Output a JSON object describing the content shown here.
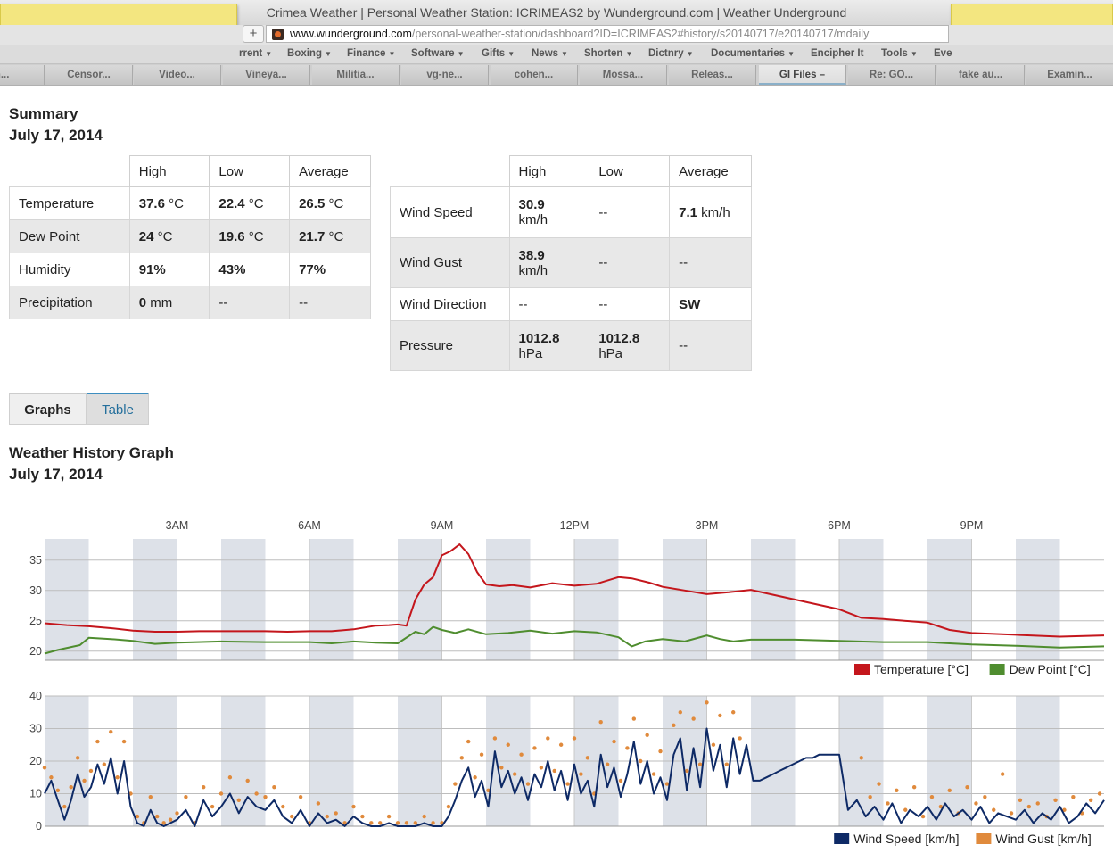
{
  "browser": {
    "window_title": "Crimea Weather | Personal Weather Station: ICRIMEAS2 by Wunderground.com | Weather Underground",
    "url_host": "www.wunderground.com",
    "url_path": "/personal-weather-station/dashboard?ID=ICRIMEAS2#history/s20140717/e20140717/mdaily",
    "add_symbol": "+",
    "bookmarks": [
      "rrent",
      "Boxing",
      "Finance",
      "Software",
      "Gifts",
      "News",
      "Shorten",
      "Dictnry",
      "Documentaries",
      "Encipher It",
      "Tools",
      "Eve"
    ],
    "bookmark_caret": "▼",
    "tabs": [
      "m...",
      "Censor...",
      "Video...",
      "Vineya...",
      "Militia...",
      "vg-ne...",
      "cohen...",
      "Mossa...",
      "Releas...",
      "GI Files –",
      "Re: GO...",
      "fake au...",
      "Examin..."
    ],
    "active_tab": "GI Files –"
  },
  "summary": {
    "title": "Summary",
    "date": "July 17, 2014",
    "left_table": {
      "headers": [
        "High",
        "Low",
        "Average"
      ],
      "rows": [
        {
          "label": "Temperature",
          "high": "37.6",
          "high_unit": "°C",
          "low": "22.4",
          "low_unit": "°C",
          "avg": "26.5",
          "avg_unit": "°C"
        },
        {
          "label": "Dew Point",
          "high": "24",
          "high_unit": "°C",
          "low": "19.6",
          "low_unit": "°C",
          "avg": "21.7",
          "avg_unit": "°C"
        },
        {
          "label": "Humidity",
          "high": "91%",
          "high_unit": "",
          "low": "43%",
          "low_unit": "",
          "avg": "77%",
          "avg_unit": ""
        },
        {
          "label": "Precipitation",
          "high": "0",
          "high_unit": "mm",
          "low": "--",
          "low_unit": "",
          "avg": "--",
          "avg_unit": ""
        }
      ]
    },
    "right_table": {
      "headers": [
        "High",
        "Low",
        "Average"
      ],
      "rows": [
        {
          "label": "Wind Speed",
          "high": "30.9",
          "high_unit": "km/h",
          "low": "--",
          "low_unit": "",
          "avg": "7.1",
          "avg_unit": "km/h"
        },
        {
          "label": "Wind Gust",
          "high": "38.9",
          "high_unit": "km/h",
          "low": "--",
          "low_unit": "",
          "avg": "--",
          "avg_unit": ""
        },
        {
          "label": "Wind Direction",
          "high": "--",
          "high_unit": "",
          "low": "--",
          "low_unit": "",
          "avg": "SW",
          "avg_unit": ""
        },
        {
          "label": "Pressure",
          "high": "1012.8",
          "high_unit": "hPa",
          "low": "1012.8",
          "low_unit": "hPa",
          "avg": "--",
          "avg_unit": ""
        }
      ]
    }
  },
  "view_tabs": {
    "graphs": "Graphs",
    "table": "Table",
    "selected": "Graphs"
  },
  "history": {
    "title": "Weather History Graph",
    "date": "July 17, 2014"
  },
  "colors": {
    "temperature": "#c4161c",
    "dewpoint": "#4f8d2f",
    "wind_speed": "#0e2a66",
    "wind_gust": "#e08a3c",
    "band": "#dde1e8"
  },
  "chart_data": [
    {
      "type": "line",
      "x_axis_unit": "hour of day",
      "x_ticks": [
        {
          "hour": 3,
          "label": "3AM"
        },
        {
          "hour": 6,
          "label": "6AM"
        },
        {
          "hour": 9,
          "label": "9AM"
        },
        {
          "hour": 12,
          "label": "12PM"
        },
        {
          "hour": 15,
          "label": "3PM"
        },
        {
          "hour": 18,
          "label": "6PM"
        },
        {
          "hour": 21,
          "label": "9PM"
        }
      ],
      "xlim": [
        0,
        24
      ],
      "ylim": [
        18.5,
        38.5
      ],
      "y_ticks": [
        20,
        25,
        30,
        35
      ],
      "grid": true,
      "legend_position": "bottom-right",
      "series": [
        {
          "name": "Temperature [°C]",
          "x": [
            0,
            0.5,
            1,
            1.5,
            2,
            2.5,
            3,
            3.5,
            4,
            4.5,
            5,
            5.5,
            6,
            6.5,
            7,
            7.5,
            7.8,
            8,
            8.2,
            8.4,
            8.6,
            8.8,
            9,
            9.2,
            9.4,
            9.6,
            9.8,
            10,
            10.3,
            10.6,
            11,
            11.5,
            12,
            12.5,
            13,
            13.3,
            13.7,
            14,
            14.5,
            15,
            15.5,
            16,
            17,
            18,
            18.5,
            19,
            20,
            20.5,
            21,
            22,
            23,
            24
          ],
          "y": [
            24.6,
            24.3,
            24.1,
            23.8,
            23.4,
            23.2,
            23.2,
            23.3,
            23.3,
            23.3,
            23.3,
            23.2,
            23.3,
            23.3,
            23.6,
            24.2,
            24.3,
            24.4,
            24.2,
            28.5,
            31.0,
            32.2,
            35.8,
            36.5,
            37.6,
            36.0,
            33.0,
            31.0,
            30.7,
            30.9,
            30.5,
            31.2,
            30.8,
            31.1,
            32.2,
            32.0,
            31.3,
            30.6,
            30.0,
            29.4,
            29.7,
            30.1,
            28.5,
            26.9,
            25.5,
            25.3,
            24.7,
            23.5,
            23.0,
            22.7,
            22.4,
            22.6
          ]
        },
        {
          "name": "Dew Point [°C]",
          "x": [
            0,
            0.3,
            0.8,
            1,
            1.5,
            2,
            2.5,
            3,
            4,
            5,
            6,
            6.5,
            7,
            7.5,
            8,
            8.4,
            8.6,
            8.8,
            9,
            9.3,
            9.6,
            10,
            10.5,
            11,
            11.5,
            12,
            12.5,
            13,
            13.3,
            13.6,
            14,
            14.5,
            15,
            15.3,
            15.6,
            16,
            17,
            18,
            19,
            20,
            20.5,
            21,
            22,
            23,
            24
          ],
          "y": [
            19.6,
            20.2,
            21.0,
            22.2,
            22.0,
            21.7,
            21.2,
            21.4,
            21.6,
            21.5,
            21.5,
            21.3,
            21.6,
            21.4,
            21.3,
            23.2,
            22.8,
            24.0,
            23.5,
            23.0,
            23.6,
            22.8,
            23.0,
            23.4,
            22.9,
            23.3,
            23.1,
            22.3,
            20.8,
            21.6,
            22.0,
            21.6,
            22.6,
            22.0,
            21.6,
            21.9,
            21.9,
            21.7,
            21.5,
            21.5,
            21.3,
            21.1,
            20.9,
            20.6,
            20.8
          ]
        }
      ]
    },
    {
      "type": "line",
      "x_axis_unit": "hour of day",
      "xlim": [
        0,
        24
      ],
      "ylim": [
        0,
        40
      ],
      "y_ticks": [
        0,
        10,
        20,
        30,
        40
      ],
      "grid": true,
      "legend_position": "bottom-right",
      "series": [
        {
          "name": "Wind Speed [km/h]",
          "x": [
            0,
            0.15,
            0.3,
            0.45,
            0.6,
            0.75,
            0.9,
            1.05,
            1.2,
            1.35,
            1.5,
            1.65,
            1.8,
            1.95,
            2.1,
            2.25,
            2.4,
            2.55,
            2.7,
            2.85,
            3,
            3.2,
            3.4,
            3.6,
            3.8,
            4,
            4.2,
            4.4,
            4.6,
            4.8,
            5,
            5.2,
            5.4,
            5.6,
            5.8,
            6,
            6.2,
            6.4,
            6.6,
            6.8,
            7,
            7.2,
            7.4,
            7.6,
            7.8,
            8,
            8.2,
            8.4,
            8.6,
            8.8,
            9,
            9.15,
            9.3,
            9.45,
            9.6,
            9.75,
            9.9,
            10.05,
            10.2,
            10.35,
            10.5,
            10.65,
            10.8,
            10.95,
            11.1,
            11.25,
            11.4,
            11.55,
            11.7,
            11.85,
            12,
            12.15,
            12.3,
            12.45,
            12.6,
            12.75,
            12.9,
            13.05,
            13.2,
            13.35,
            13.5,
            13.65,
            13.8,
            13.95,
            14.1,
            14.25,
            14.4,
            14.55,
            14.7,
            14.85,
            15,
            15.15,
            15.3,
            15.45,
            15.6,
            15.75,
            15.9,
            16.05,
            16.2,
            16.35,
            16.5,
            16.65,
            16.8,
            16.95,
            17.1,
            17.25,
            17.4,
            17.55,
            17.7,
            17.85,
            18,
            18.2,
            18.4,
            18.6,
            18.8,
            19,
            19.2,
            19.4,
            19.6,
            19.8,
            20,
            20.2,
            20.4,
            20.6,
            20.8,
            21,
            21.2,
            21.4,
            21.6,
            21.8,
            22,
            22.2,
            22.4,
            22.6,
            22.8,
            23,
            23.2,
            23.4,
            23.6,
            23.8,
            24
          ],
          "y": [
            10,
            14,
            8,
            2,
            8,
            16,
            9,
            12,
            19,
            13,
            21,
            10,
            20,
            6,
            1,
            0,
            5,
            1,
            0,
            1,
            2,
            5,
            0,
            8,
            3,
            6,
            10,
            4,
            9,
            6,
            5,
            8,
            3,
            1,
            5,
            0,
            4,
            1,
            2,
            0,
            3,
            1,
            0,
            0,
            1,
            0,
            0,
            0,
            1,
            0,
            0,
            3,
            8,
            14,
            18,
            9,
            14,
            6,
            23,
            12,
            17,
            10,
            15,
            8,
            16,
            12,
            20,
            11,
            17,
            8,
            19,
            10,
            14,
            6,
            22,
            12,
            18,
            9,
            16,
            26,
            13,
            20,
            10,
            15,
            8,
            22,
            27,
            11,
            24,
            12,
            30,
            17,
            25,
            12,
            27,
            16,
            25,
            14,
            14,
            15,
            16,
            17,
            18,
            19,
            20,
            21,
            21,
            22,
            22,
            22,
            22,
            5,
            8,
            3,
            6,
            2,
            7,
            1,
            5,
            3,
            6,
            2,
            7,
            3,
            5,
            2,
            6,
            1,
            4,
            3,
            2,
            5,
            1,
            4,
            2,
            6,
            1,
            3,
            7,
            4,
            8
          ]
        },
        {
          "name": "Wind Gust [km/h]",
          "x": [
            0,
            0.15,
            0.3,
            0.45,
            0.6,
            0.75,
            0.9,
            1.05,
            1.2,
            1.35,
            1.5,
            1.65,
            1.8,
            1.95,
            2.1,
            2.25,
            2.4,
            2.55,
            2.7,
            2.85,
            3,
            3.2,
            3.4,
            3.6,
            3.8,
            4,
            4.2,
            4.4,
            4.6,
            4.8,
            5,
            5.2,
            5.4,
            5.6,
            5.8,
            6,
            6.2,
            6.4,
            6.6,
            6.8,
            7,
            7.2,
            7.4,
            7.6,
            7.8,
            8,
            8.2,
            8.4,
            8.6,
            8.8,
            9,
            9.15,
            9.3,
            9.45,
            9.6,
            9.75,
            9.9,
            10.05,
            10.2,
            10.35,
            10.5,
            10.65,
            10.8,
            10.95,
            11.1,
            11.25,
            11.4,
            11.55,
            11.7,
            11.85,
            12,
            12.15,
            12.3,
            12.45,
            12.6,
            12.75,
            12.9,
            13.05,
            13.2,
            13.35,
            13.5,
            13.65,
            13.8,
            13.95,
            14.1,
            14.25,
            14.4,
            14.55,
            14.7,
            14.85,
            15,
            15.15,
            15.3,
            15.45,
            15.6,
            15.75,
            18.5,
            18.7,
            18.9,
            19.1,
            19.3,
            19.5,
            19.7,
            19.9,
            20.1,
            20.3,
            20.5,
            20.7,
            20.9,
            21.1,
            21.3,
            21.5,
            21.7,
            21.9,
            22.1,
            22.3,
            22.5,
            22.7,
            22.9,
            23.1,
            23.3,
            23.5,
            23.7,
            23.9
          ],
          "y": [
            18,
            15,
            11,
            6,
            12,
            21,
            14,
            17,
            26,
            19,
            29,
            15,
            26,
            10,
            3,
            1,
            9,
            3,
            1,
            2,
            4,
            9,
            1,
            12,
            6,
            10,
            15,
            8,
            14,
            10,
            9,
            12,
            6,
            3,
            9,
            1,
            7,
            3,
            4,
            1,
            6,
            3,
            1,
            1,
            3,
            1,
            1,
            1,
            3,
            1,
            1,
            6,
            13,
            21,
            26,
            15,
            22,
            11,
            27,
            18,
            25,
            16,
            22,
            13,
            24,
            18,
            27,
            17,
            25,
            13,
            27,
            16,
            21,
            10,
            32,
            19,
            26,
            14,
            24,
            33,
            20,
            28,
            16,
            23,
            13,
            31,
            35,
            17,
            33,
            19,
            38,
            25,
            34,
            19,
            35,
            27,
            21,
            9,
            13,
            7,
            11,
            5,
            12,
            3,
            9,
            6,
            11,
            4,
            12,
            7,
            9,
            5,
            16,
            4,
            8,
            6,
            7,
            3,
            8,
            5,
            9,
            4,
            8,
            10
          ]
        }
      ]
    }
  ]
}
